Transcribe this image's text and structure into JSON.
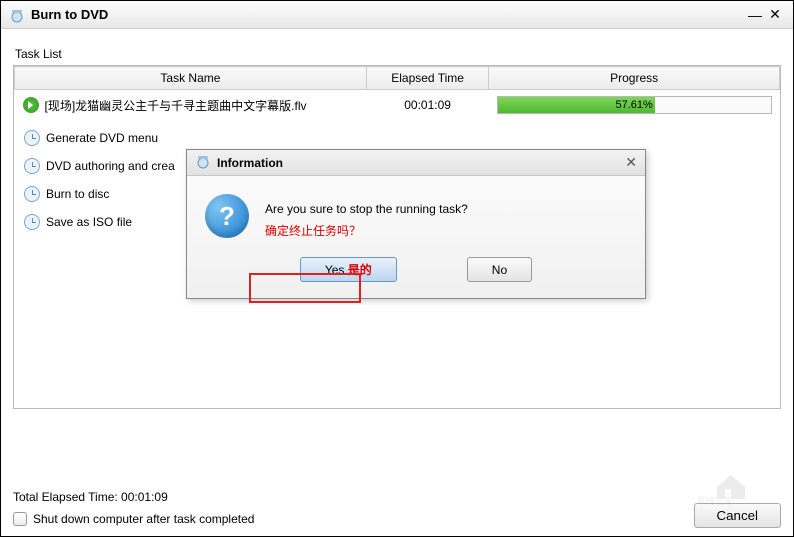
{
  "window": {
    "title": "Burn to DVD"
  },
  "taskList": {
    "label": "Task List",
    "columns": {
      "name": "Task Name",
      "time": "Elapsed Time",
      "progress": "Progress"
    },
    "active": {
      "name": "[现场]龙猫幽灵公主千与千寻主题曲中文字幕版.flv",
      "elapsed": "00:01:09",
      "progressPercent": 57.61,
      "progressText": "57.61%"
    },
    "pending": [
      {
        "label": "Generate DVD menu"
      },
      {
        "label": "DVD authoring and crea"
      },
      {
        "label": "Burn to disc"
      },
      {
        "label": "Save as ISO file"
      }
    ]
  },
  "modal": {
    "title": "Information",
    "message": "Are you sure to stop the running task?",
    "sub": "确定终止任务吗？",
    "yesPrefix": "Yes ",
    "yesRed": "是的",
    "no": "No"
  },
  "footer": {
    "elapsedLabel": "Total Elapsed Time:  00:01:09",
    "shutdown": "Shut down computer after task completed",
    "cancel": "Cancel"
  }
}
